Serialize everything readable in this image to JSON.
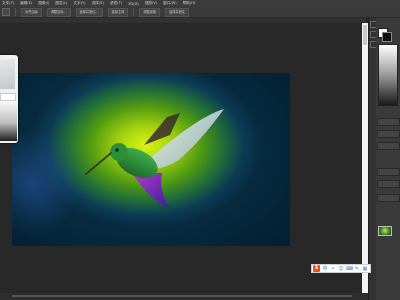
{
  "menubar": {
    "items": [
      "文件(F)",
      "编辑(E)",
      "图像(I)",
      "图层(L)",
      "文字(Y)",
      "选择(S)",
      "滤镜(T)",
      "3D(D)",
      "视图(V)",
      "窗口(W)",
      "帮助(H)"
    ]
  },
  "options": {
    "buttons": [
      "对齐边缘",
      "调整边缘...",
      "选择并遮住...",
      "选择主体",
      "调整设置",
      "选择并遮住"
    ]
  },
  "ime": {
    "logo": "S",
    "icons": [
      "中",
      "•",
      "☺",
      "⌨",
      "✎",
      "▦"
    ]
  },
  "colors": {
    "canvas_bg": "#282828",
    "panel_bg": "#3a3a3a",
    "menu_bg": "#3c3c3c",
    "accent_ime": "#e8511c"
  }
}
